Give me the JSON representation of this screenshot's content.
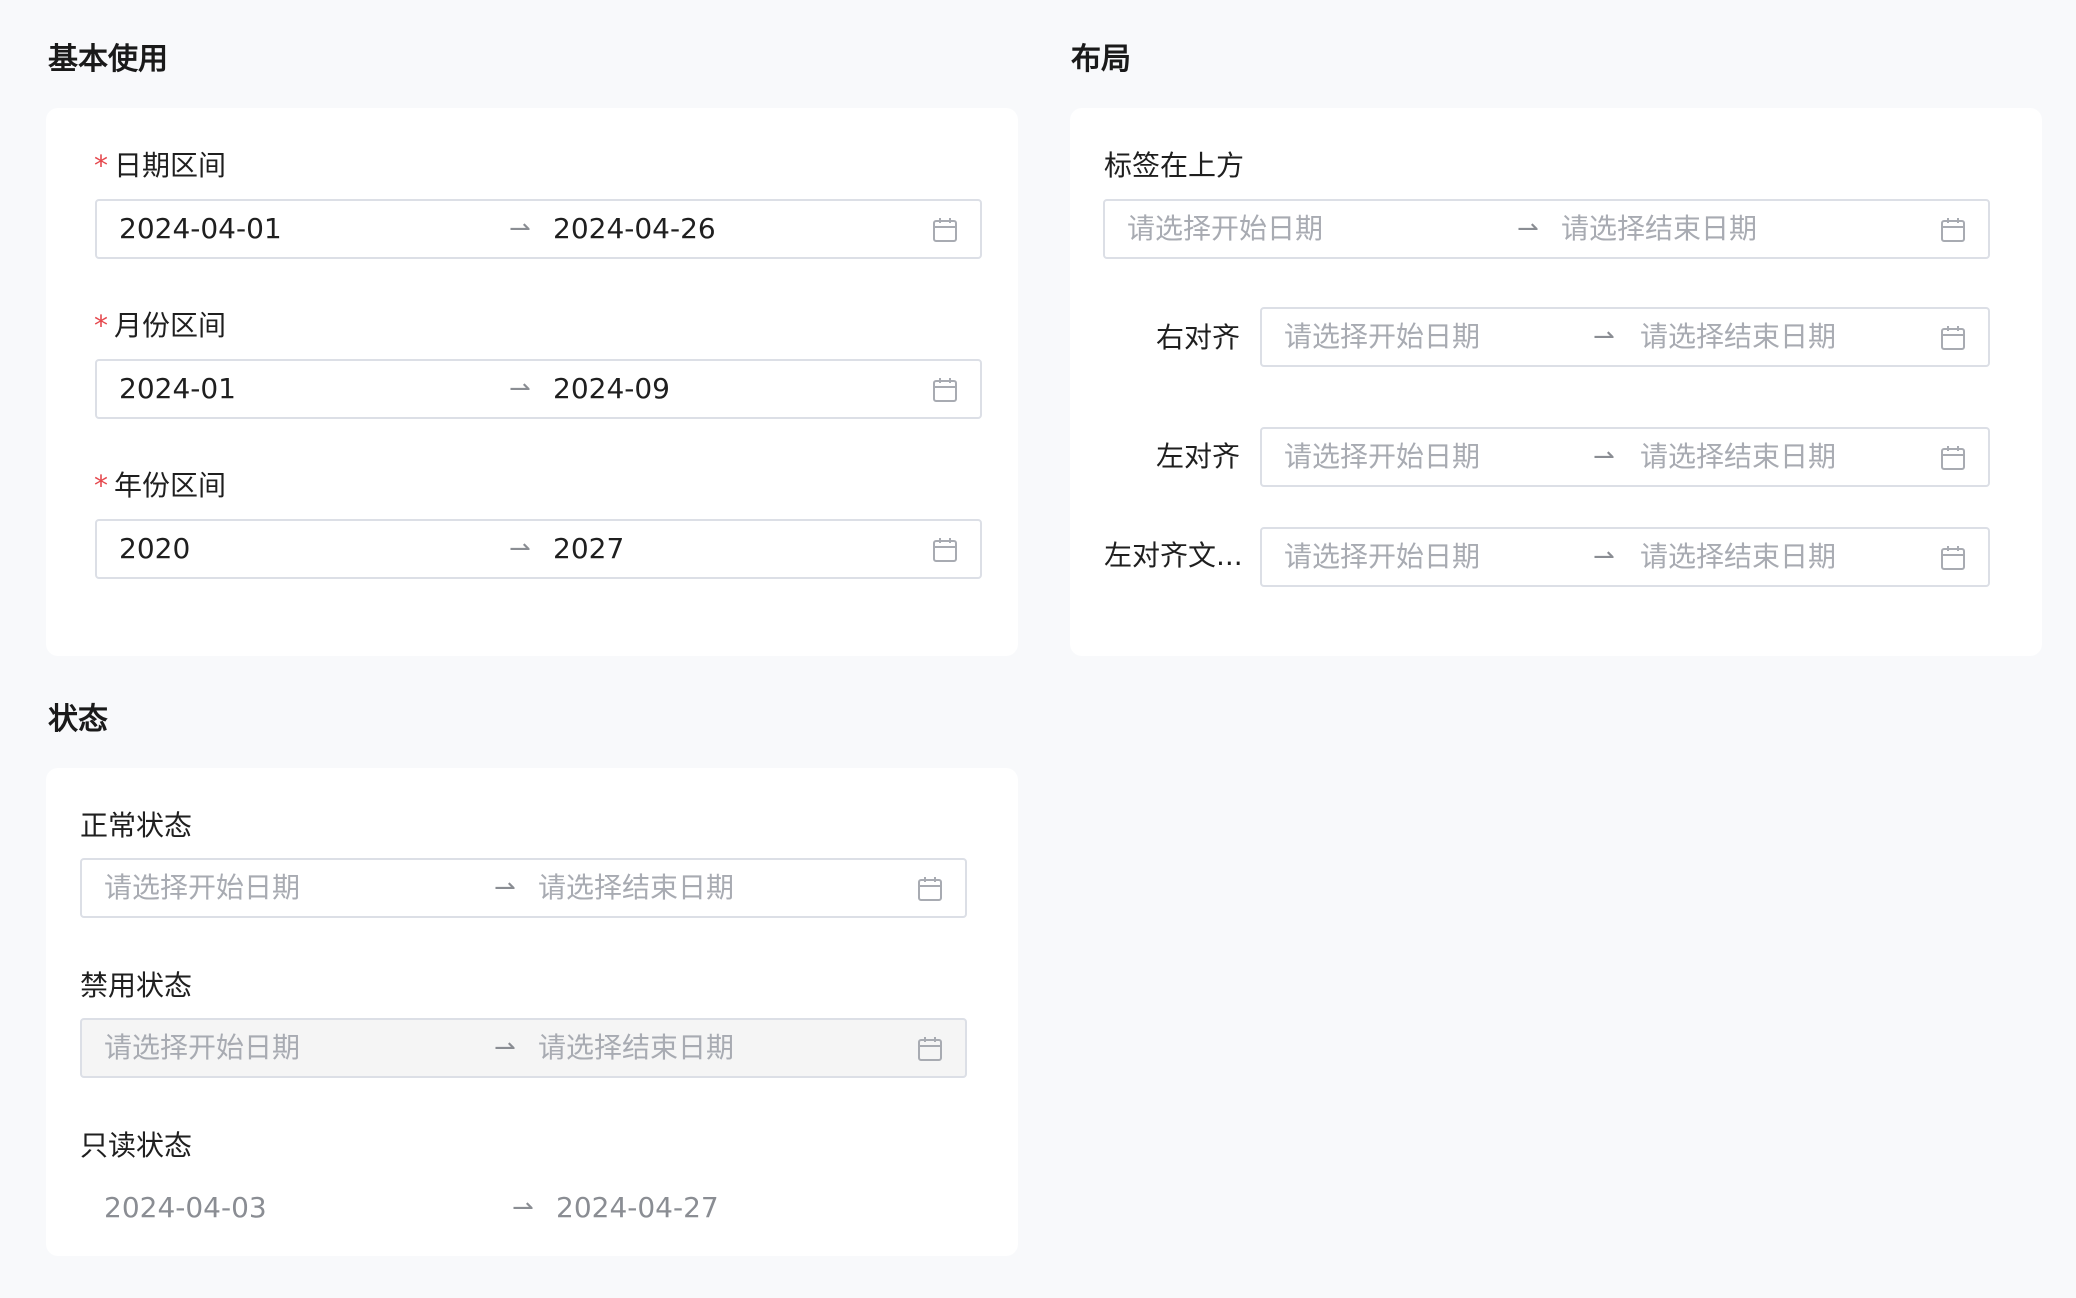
{
  "basic": {
    "title": "基本使用",
    "fields": [
      {
        "label": "日期区间",
        "start": "2024-04-01",
        "end": "2024-04-26"
      },
      {
        "label": "月份区间",
        "start": "2024-01",
        "end": "2024-09"
      },
      {
        "label": "年份区间",
        "start": "2020",
        "end": "2027"
      }
    ]
  },
  "layout": {
    "title": "布局",
    "fields": [
      {
        "label": "标签在上方"
      },
      {
        "label": "右对齐"
      },
      {
        "label": "左对齐"
      },
      {
        "label": "左对齐文..."
      }
    ]
  },
  "status": {
    "title": "状态",
    "fields": [
      {
        "label": "正常状态"
      },
      {
        "label": "禁用状态"
      },
      {
        "label": "只读状态",
        "start": "2024-04-03",
        "end": "2024-04-27"
      }
    ]
  },
  "common": {
    "required_mark": "*",
    "start_placeholder": "请选择开始日期",
    "end_placeholder": "请选择结束日期",
    "separator": "⇀"
  },
  "icons": {
    "calendar": "calendar-icon"
  },
  "colors": {
    "page_bg": "#f8f9fb",
    "card_bg": "#ffffff",
    "required": "#e5484d",
    "border": "#dcdfe6",
    "placeholder": "#a8abb2",
    "disabled_bg": "#f5f5f5"
  }
}
